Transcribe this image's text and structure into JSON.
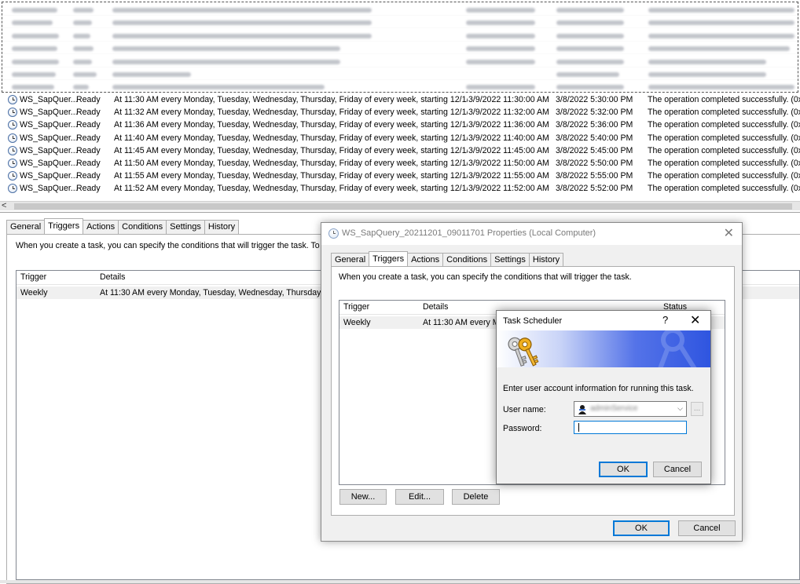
{
  "task_list": {
    "rows": [
      {
        "name": "WS_SapQuer...",
        "status": "Ready",
        "triggers": "At 11:30 AM every Monday, Tuesday, Wednesday, Thursday, Friday of every week, starting 12/1/2...",
        "next_run": "3/9/2022 11:30:00 AM",
        "last_run": "3/8/2022 5:30:00 PM",
        "result": "The operation completed successfully. (0x0"
      },
      {
        "name": "WS_SapQuer...",
        "status": "Ready",
        "triggers": "At 11:32 AM every Monday, Tuesday, Wednesday, Thursday, Friday of every week, starting 12/1/2...",
        "next_run": "3/9/2022 11:32:00 AM",
        "last_run": "3/8/2022 5:32:00 PM",
        "result": "The operation completed successfully. (0x0"
      },
      {
        "name": "WS_SapQuer...",
        "status": "Ready",
        "triggers": "At 11:36 AM every Monday, Tuesday, Wednesday, Thursday, Friday of every week, starting 12/1/2...",
        "next_run": "3/9/2022 11:36:00 AM",
        "last_run": "3/8/2022 5:36:00 PM",
        "result": "The operation completed successfully. (0x0"
      },
      {
        "name": "WS_SapQuer...",
        "status": "Ready",
        "triggers": "At 11:40 AM every Monday, Tuesday, Wednesday, Thursday, Friday of every week, starting 12/1/2...",
        "next_run": "3/9/2022 11:40:00 AM",
        "last_run": "3/8/2022 5:40:00 PM",
        "result": "The operation completed successfully. (0x0"
      },
      {
        "name": "WS_SapQuer...",
        "status": "Ready",
        "triggers": "At 11:45 AM every Monday, Tuesday, Wednesday, Thursday, Friday of every week, starting 12/1/2...",
        "next_run": "3/9/2022 11:45:00 AM",
        "last_run": "3/8/2022 5:45:00 PM",
        "result": "The operation completed successfully. (0x0"
      },
      {
        "name": "WS_SapQuer...",
        "status": "Ready",
        "triggers": "At 11:50 AM every Monday, Tuesday, Wednesday, Thursday, Friday of every week, starting 12/1/2...",
        "next_run": "3/9/2022 11:50:00 AM",
        "last_run": "3/8/2022 5:50:00 PM",
        "result": "The operation completed successfully. (0x0"
      },
      {
        "name": "WS_SapQuer...",
        "status": "Ready",
        "triggers": "At 11:55 AM every Monday, Tuesday, Wednesday, Thursday, Friday of every week, starting 12/1/2...",
        "next_run": "3/9/2022 11:55:00 AM",
        "last_run": "3/8/2022 5:55:00 PM",
        "result": "The operation completed successfully. (0x0"
      },
      {
        "name": "WS_SapQuer...",
        "status": "Ready",
        "triggers": "At 11:52 AM every Monday, Tuesday, Wednesday, Thursday, Friday of every week, starting 12/1/2...",
        "next_run": "3/9/2022 11:52:00 AM",
        "last_run": "3/8/2022 5:52:00 PM",
        "result": "The operation completed successfully. (0x0"
      }
    ],
    "scroll_left_glyph": "<"
  },
  "detail_pane": {
    "tabs": [
      "General",
      "Triggers",
      "Actions",
      "Conditions",
      "Settings",
      "History"
    ],
    "description": "When you create a task, you can specify the conditions that will trigger the task.  To cha",
    "columns": {
      "trigger": "Trigger",
      "details": "Details"
    },
    "row": {
      "trigger": "Weekly",
      "details": "At 11:30 AM every Monday, Tuesday, Wednesday, Thursday, Fri"
    }
  },
  "properties_dialog": {
    "title": "WS_SapQuery_20211201_09011701 Properties (Local Computer)",
    "close_glyph": "✕",
    "tabs": [
      "General",
      "Triggers",
      "Actions",
      "Conditions",
      "Settings",
      "History"
    ],
    "description": "When you create a task, you can specify the conditions that will trigger the task.",
    "columns": {
      "trigger": "Trigger",
      "details": "Details",
      "status": "Status"
    },
    "row": {
      "trigger": "Weekly",
      "details": "At 11:30 AM every M"
    },
    "buttons": {
      "new": "New...",
      "edit": "Edit...",
      "delete": "Delete",
      "ok": "OK",
      "cancel": "Cancel"
    }
  },
  "credential_dialog": {
    "title": "Task Scheduler",
    "help_glyph": "?",
    "close_glyph": "✕",
    "info": "Enter user account information for running this task.",
    "user_label": "User name:",
    "password_label": "Password:",
    "user_value_redacted": "adminService",
    "browse_label": "...",
    "chevron_glyph": "⌵",
    "ok": "OK",
    "cancel": "Cancel"
  },
  "icons": {
    "task_row": "clock-icon",
    "banner": "keys-icon",
    "user": "user-avatar-icon"
  }
}
